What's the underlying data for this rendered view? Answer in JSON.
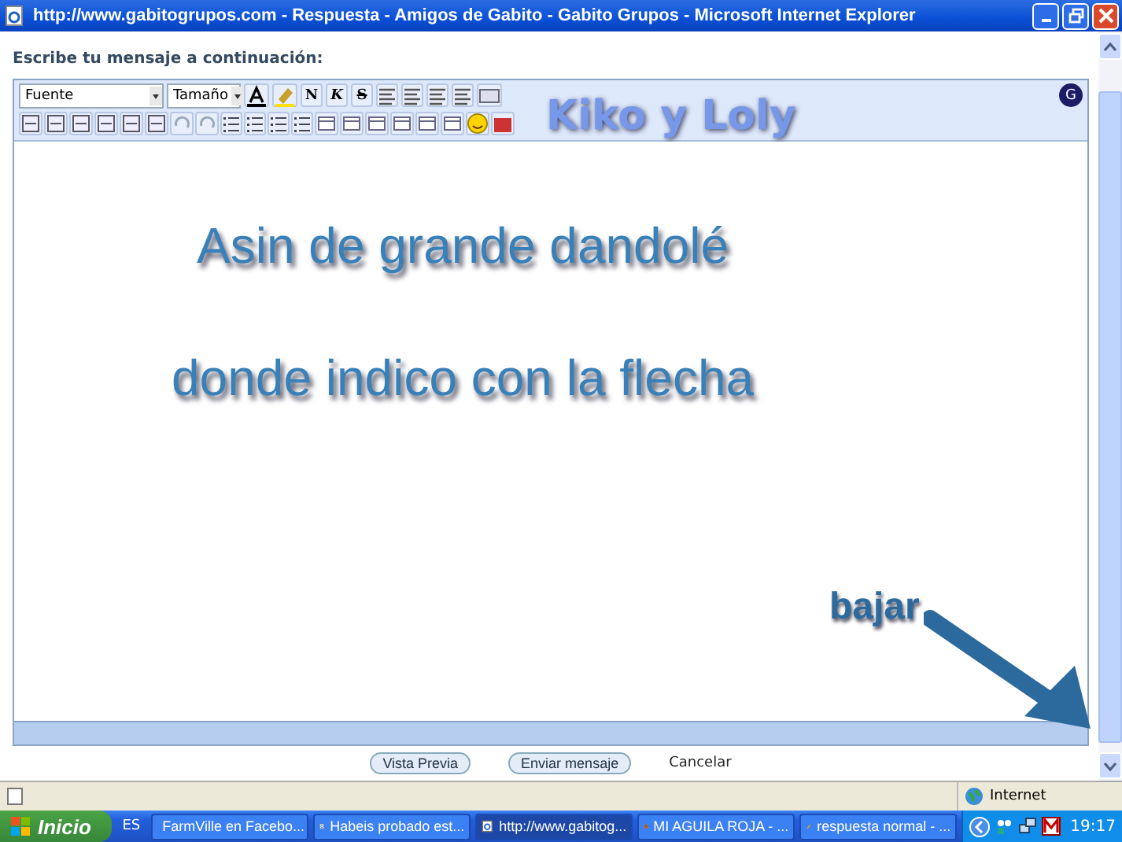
{
  "window": {
    "title": "http://www.gabitogrupos.com - Respuesta - Amigos de Gabito - Gabito Grupos - Microsoft Internet Explorer"
  },
  "page": {
    "prompt": "Escribe tu mensaje a continuación:",
    "editor": {
      "font_select": "Fuente",
      "size_select": "Tamaño",
      "format_buttons": [
        "N",
        "K",
        "S"
      ],
      "badge": "G",
      "overlay_text": "Kiko y Loly",
      "body_lines": [
        "Asin de grande dandolé",
        "donde indico con la flecha"
      ],
      "annotation": "bajar"
    },
    "buttons": [
      "Vista Previa",
      "Enviar mensaje"
    ],
    "cancel_link": "Cancelar"
  },
  "status_bar": {
    "zone": "Internet"
  },
  "taskbar": {
    "start": "Inicio",
    "language": "ES",
    "tasks": [
      {
        "label": "FarmVille en Facebo...",
        "kind": "ie",
        "selected": false
      },
      {
        "label": "Habeis probado est...",
        "kind": "ie",
        "selected": false
      },
      {
        "label": "http://www.gabitog...",
        "kind": "ie",
        "selected": true
      },
      {
        "label": "MI AGUILA ROJA - ...",
        "kind": "firefox",
        "selected": false
      },
      {
        "label": "respuesta normal - ...",
        "kind": "paint",
        "selected": false
      }
    ],
    "clock": "19:17"
  }
}
